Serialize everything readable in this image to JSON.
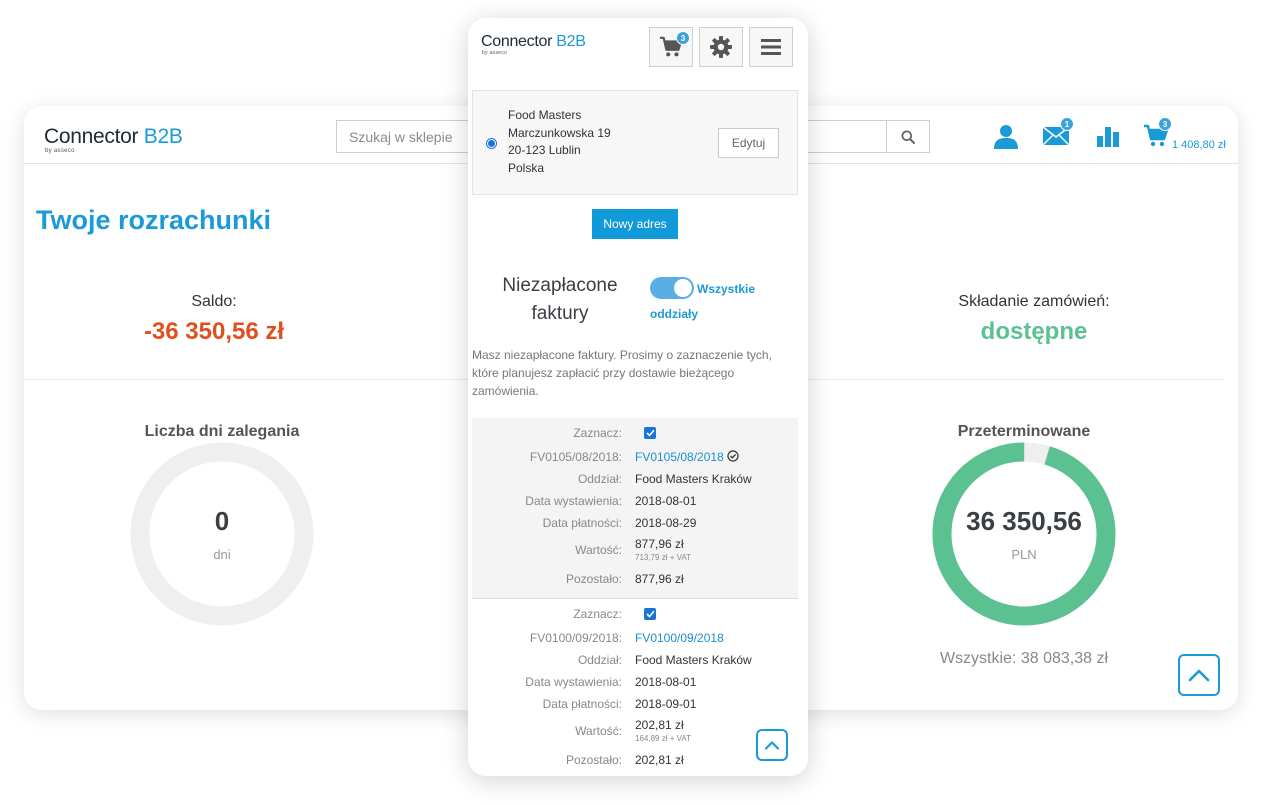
{
  "brand": {
    "name": "Connector",
    "suffix": "B2B",
    "byline": "by asseco",
    "accent": "#1a9ad6"
  },
  "desktop": {
    "search_placeholder": "Szukaj w sklepie",
    "icons": [
      "user-icon",
      "mail-icon",
      "chart-icon",
      "cart-icon",
      "search-icon"
    ],
    "mail_badge": "1",
    "cart_badge": "3",
    "cart_total": "1 408,80 zł",
    "page_title": "Twoje rozrachunki",
    "saldo_label": "Saldo:",
    "saldo_value": "-36 350,56 zł",
    "orders_label": "Składanie zamówień:",
    "orders_value": "dostępne",
    "overdue_days": {
      "title": "Liczba dni zalegania",
      "value": "0",
      "unit": "dni"
    },
    "overdue_amount": {
      "title": "Przeterminowane",
      "value": "36 350,56",
      "unit": "PLN",
      "total": "Wszystkie: 38 083,38 zł",
      "fraction": 0.9545,
      "color": "#5cc190"
    }
  },
  "mobile": {
    "cart_badge": "3",
    "address": {
      "lines": [
        "Food Masters",
        "Marczunkowska 19",
        "20-123  Lublin",
        "Polska"
      ],
      "edit_label": "Edytuj"
    },
    "new_address_label": "Nowy adres",
    "unpaid_title_line1": "Niezapłacone",
    "unpaid_title_line2": "faktury",
    "toggle_label": "Wszystkie oddziały",
    "info_text": "Masz niezapłacone faktury. Prosimy o zaznaczenie tych, które planujesz zapłacić przy dostawie bieżącego zamówienia.",
    "invoices": [
      {
        "select_label": "Zaznacz:",
        "number_label": "FV0105/08/2018:",
        "number": "FV0105/08/2018",
        "branch_label": "Oddział:",
        "branch": "Food Masters Kraków",
        "issue_label": "Data wystawienia:",
        "issue_date": "2018-08-01",
        "due_label": "Data płatności:",
        "due_date": "2018-08-29",
        "value_label": "Wartość:",
        "value": "877,96 zł",
        "value_net": "713,79 zł + VAT",
        "remaining_label": "Pozostało:",
        "remaining": "877,96 zł"
      },
      {
        "select_label": "Zaznacz:",
        "number_label": "FV0100/09/2018:",
        "number": "FV0100/09/2018",
        "branch_label": "Oddział:",
        "branch": "Food Masters Kraków",
        "issue_label": "Data wystawienia:",
        "issue_date": "2018-08-01",
        "due_label": "Data płatności:",
        "due_date": "2018-09-01",
        "value_label": "Wartość:",
        "value": "202,81 zł",
        "value_net": "164,89 zł + VAT",
        "remaining_label": "Pozostało:",
        "remaining": "202,81 zł"
      }
    ]
  }
}
